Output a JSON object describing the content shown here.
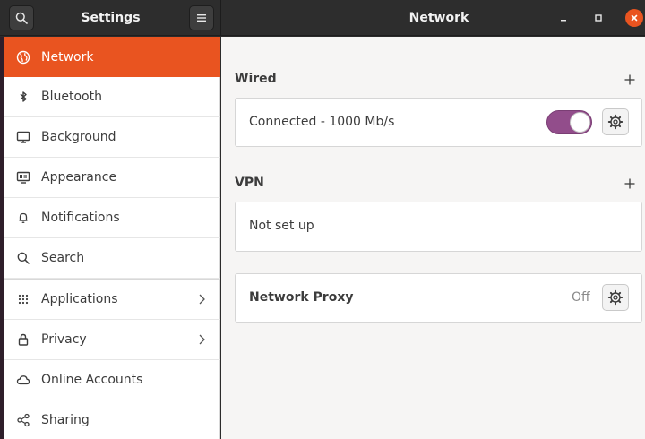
{
  "header": {
    "settings_title": "Settings",
    "panel_title": "Network",
    "search_icon": "search-icon",
    "menu_icon": "hamburger-menu-icon"
  },
  "window_controls": {
    "minimize_icon": "minimize-icon",
    "maximize_icon": "maximize-icon",
    "close_icon": "close-icon",
    "close_color": "#e95420"
  },
  "sidebar": {
    "accent_color": "#e95420",
    "items": [
      {
        "label": "Network",
        "icon": "globe-icon",
        "active": true
      },
      {
        "label": "Bluetooth",
        "icon": "bluetooth-icon"
      },
      {
        "label": "Background",
        "icon": "monitor-icon"
      },
      {
        "label": "Appearance",
        "icon": "appearance-icon"
      },
      {
        "label": "Notifications",
        "icon": "bell-icon"
      },
      {
        "label": "Search",
        "icon": "search-icon"
      },
      {
        "label": "Applications",
        "icon": "grid-icon",
        "has_submenu": true
      },
      {
        "label": "Privacy",
        "icon": "lock-icon",
        "has_submenu": true
      },
      {
        "label": "Online Accounts",
        "icon": "cloud-icon"
      },
      {
        "label": "Sharing",
        "icon": "share-icon"
      }
    ]
  },
  "main": {
    "wired": {
      "title": "Wired",
      "status": "Connected - 1000 Mb/s",
      "toggle_on": true,
      "toggle_color": "#924d8b"
    },
    "vpn": {
      "title": "VPN",
      "status": "Not set up"
    },
    "proxy": {
      "title": "Network Proxy",
      "value": "Off"
    }
  }
}
